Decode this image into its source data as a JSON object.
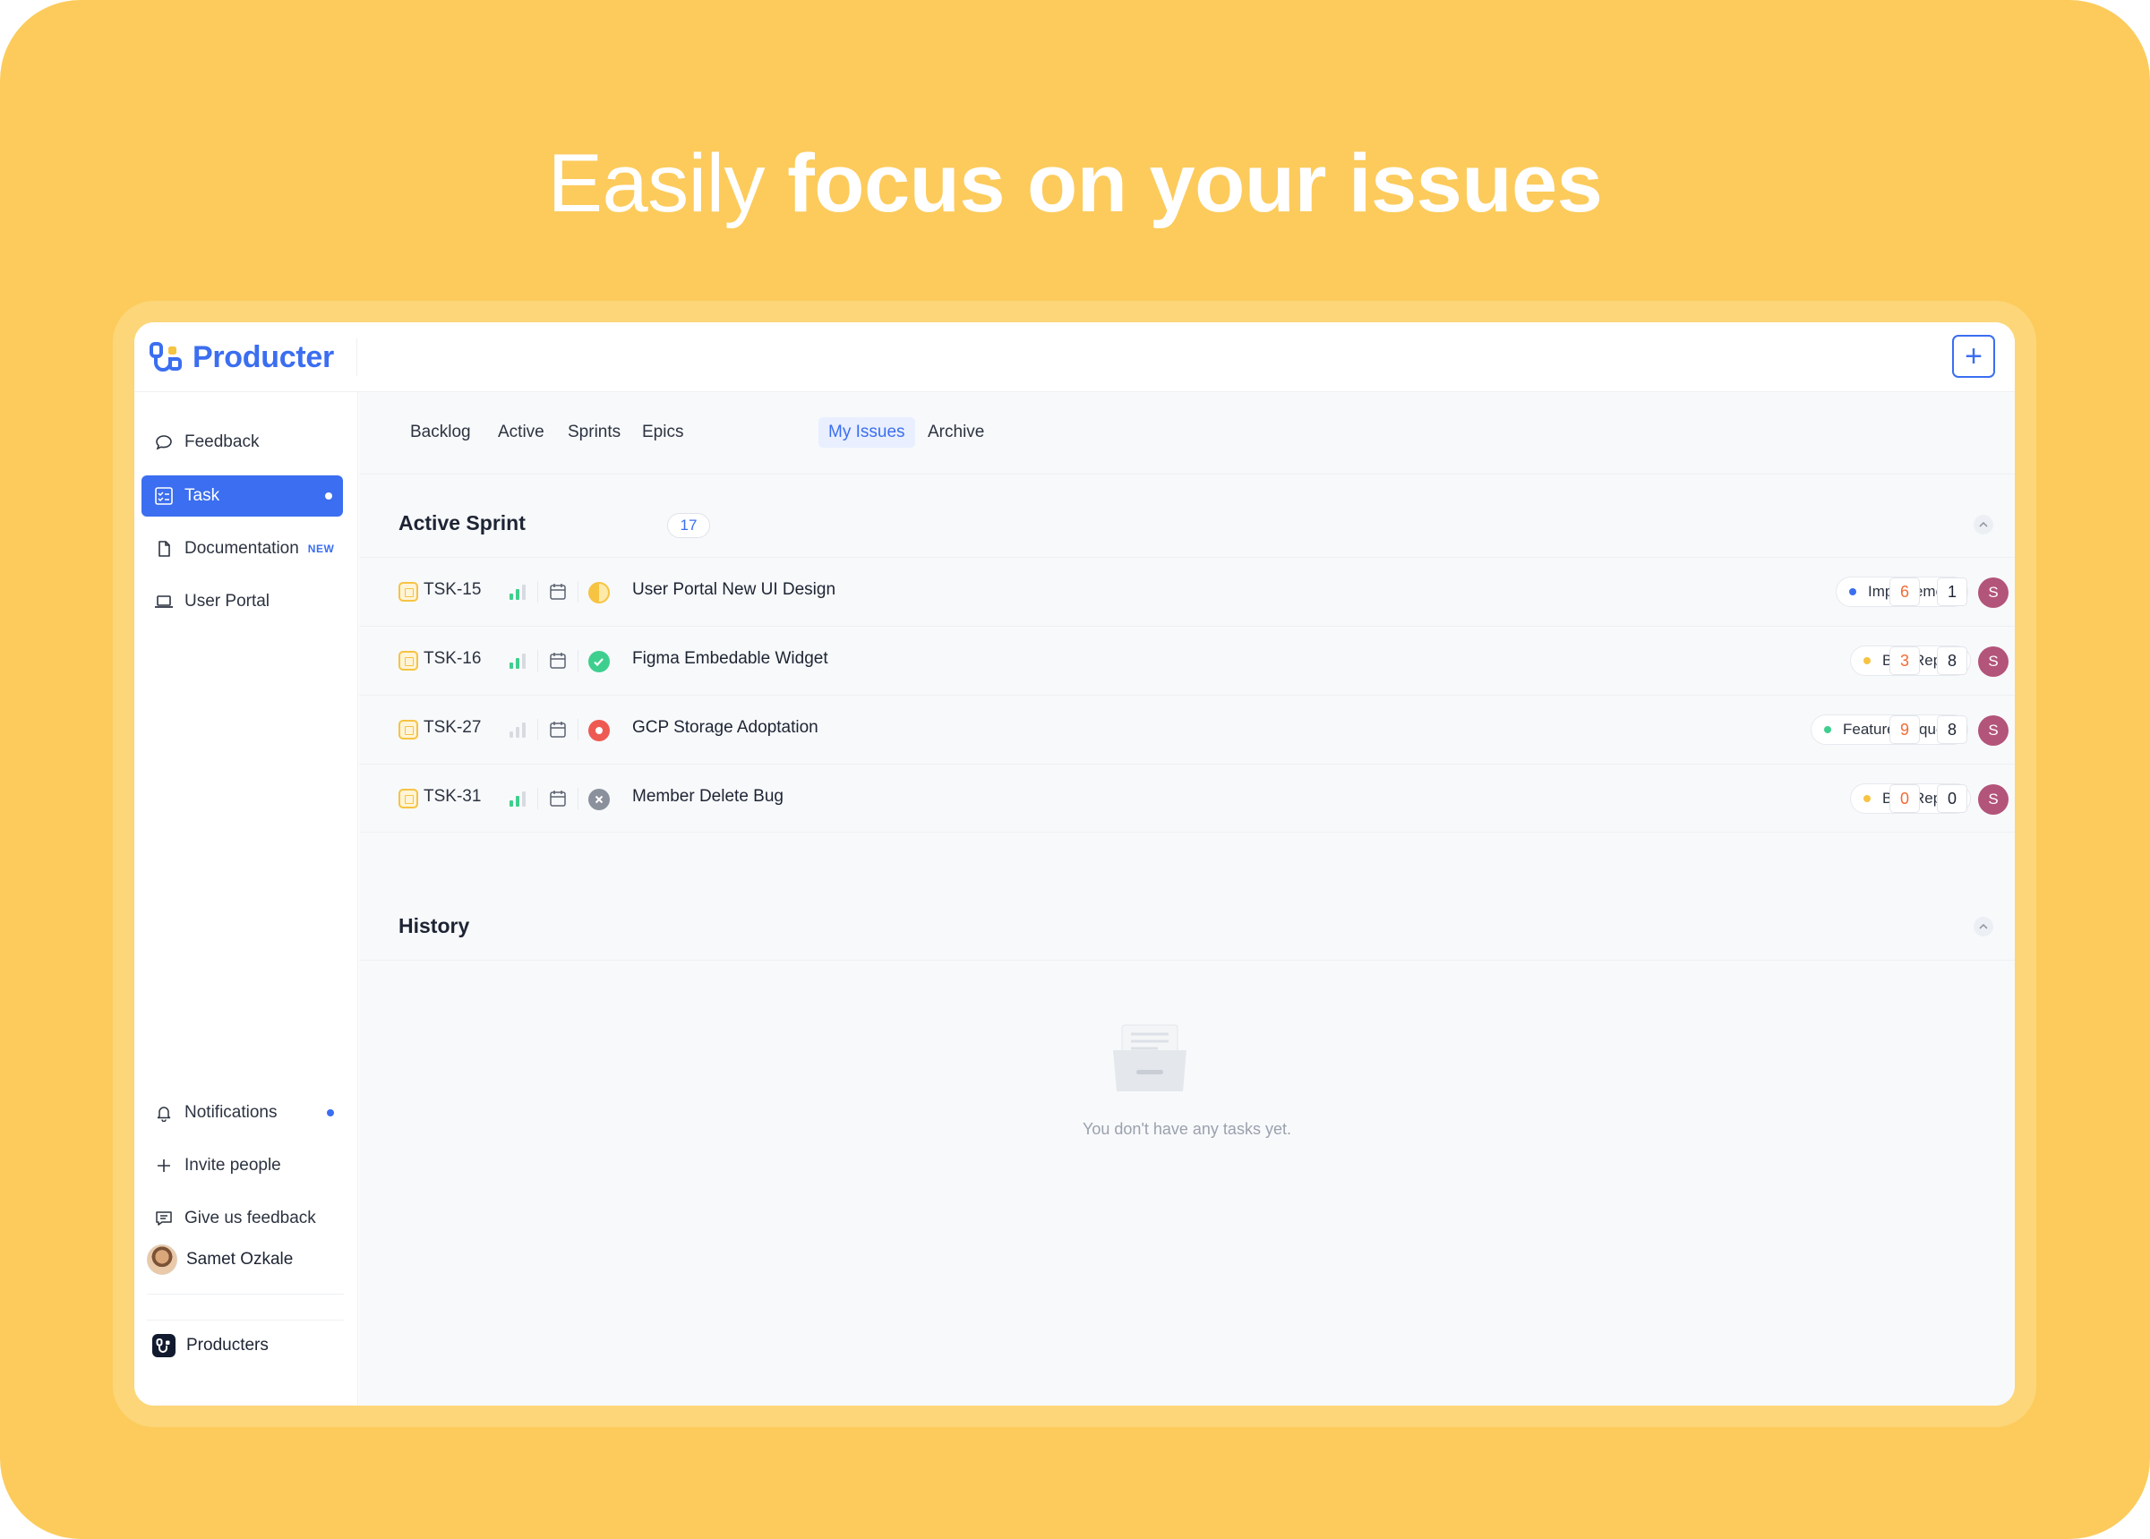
{
  "hero": {
    "light": "Easily",
    "bold": "focus on your issues"
  },
  "app": {
    "logo_text": "Producter",
    "add_button_label": "+"
  },
  "sidebar": {
    "items": [
      {
        "label": "Feedback",
        "icon": "chat-bubble-icon",
        "active": false
      },
      {
        "label": "Task",
        "icon": "task-list-icon",
        "active": true
      },
      {
        "label": "Documentation",
        "icon": "document-icon",
        "active": false,
        "badge": "NEW"
      },
      {
        "label": "User Portal",
        "icon": "laptop-icon",
        "active": false
      }
    ],
    "bottom_items": [
      {
        "label": "Notifications",
        "icon": "bell-icon"
      },
      {
        "label": "Invite people",
        "icon": "plus-icon"
      },
      {
        "label": "Give us feedback",
        "icon": "message-icon"
      }
    ],
    "user_name": "Samet Ozkale",
    "org_name": "Producters"
  },
  "tabs": [
    {
      "label": "Backlog",
      "active": false
    },
    {
      "label": "Active",
      "active": false
    },
    {
      "label": "Sprints",
      "active": false
    },
    {
      "label": "Epics",
      "active": false
    },
    {
      "label": "My Issues",
      "active": true
    },
    {
      "label": "Archive",
      "active": false
    }
  ],
  "active_sprint": {
    "title": "Active Sprint",
    "count": "17",
    "issues": [
      {
        "id": "TSK-15",
        "title": "User Portal New UI Design",
        "status": "in-progress",
        "status_color": "#f6c343",
        "tag": "Improvement",
        "tag_color": "#3b6ef0",
        "num1": "6",
        "num2": "1",
        "assignee": "S",
        "priority_bars": 2
      },
      {
        "id": "TSK-16",
        "title": "Figma Embedable Widget",
        "status": "done",
        "status_color": "#3ecf8e",
        "tag": "Bug Report",
        "tag_color": "#f6c343",
        "num1": "3",
        "num2": "8",
        "assignee": "S",
        "priority_bars": 2
      },
      {
        "id": "TSK-27",
        "title": "GCP Storage Adoptation",
        "status": "blocked",
        "status_color": "#ee5a52",
        "tag": "Feature Request",
        "tag_color": "#3ecf8e",
        "num1": "9",
        "num2": "8",
        "assignee": "S",
        "priority_bars": 0
      },
      {
        "id": "TSK-31",
        "title": "Member Delete Bug",
        "status": "cancelled",
        "status_color": "#8a919c",
        "tag": "Bug Report",
        "tag_color": "#f6c343",
        "num1": "0",
        "num2": "0",
        "assignee": "S",
        "priority_bars": 2
      }
    ]
  },
  "history": {
    "title": "History",
    "empty_text": "You don't have any tasks yet."
  }
}
